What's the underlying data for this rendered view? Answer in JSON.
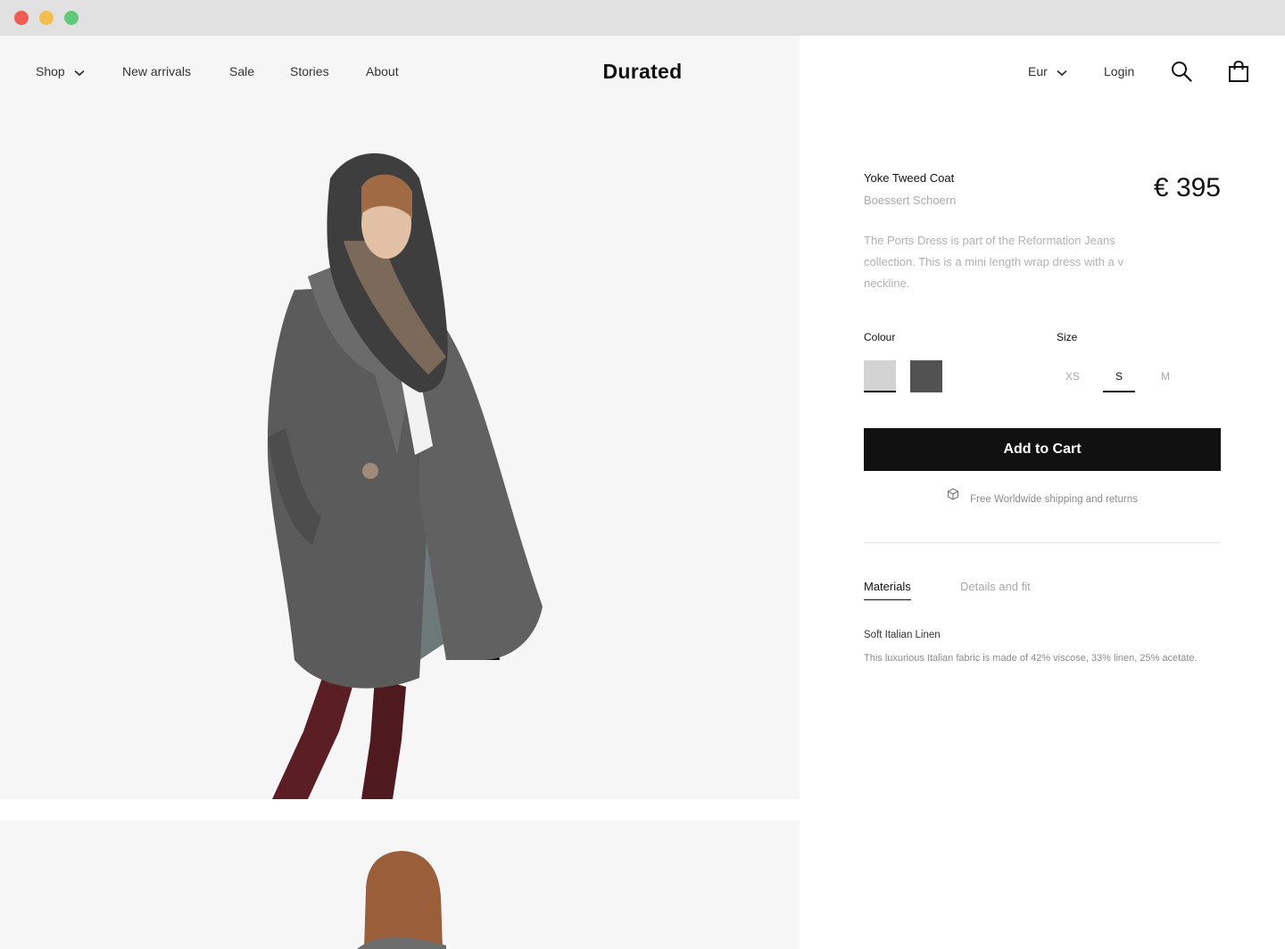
{
  "nav": {
    "left": [
      {
        "label": "Shop",
        "has_dropdown": true
      },
      {
        "label": "New arrivals"
      },
      {
        "label": "Sale"
      },
      {
        "label": "Stories"
      },
      {
        "label": "About"
      }
    ],
    "logo": "Durated",
    "currency": {
      "label": "Eur",
      "has_dropdown": true
    },
    "login": "Login",
    "icons": [
      "search-icon",
      "shopping-bag-icon"
    ]
  },
  "product": {
    "name": "Yoke Tweed Coat",
    "brand": "Boessert Schoern",
    "price": "€ 395",
    "description": "The Ports Dress is part of the Reformation Jeans collection. This is a mini length wrap dress with a v neckline.",
    "colour_label": "Colour",
    "colours": [
      {
        "name": "light-grey",
        "hex": "#d3d3d3",
        "selected": true
      },
      {
        "name": "dark-grey",
        "hex": "#525252",
        "selected": false
      }
    ],
    "size_label": "Size",
    "sizes": [
      {
        "label": "XS",
        "selected": false
      },
      {
        "label": "S",
        "selected": true
      },
      {
        "label": "M",
        "selected": false
      }
    ],
    "cta": "Add to Cart",
    "shipping_note": "Free Worldwide shipping and returns"
  },
  "tabs": [
    {
      "label": "Materials",
      "active": true
    },
    {
      "label": "Details and fit",
      "active": false
    }
  ],
  "materials": {
    "title": "Soft Italian Linen",
    "body": "This luxurious Italian fabric is made of 42% viscose, 33% linen, 25% acetate."
  },
  "colors": {
    "gallery_bg": "#f6f6f6",
    "cta_bg": "#111111",
    "muted_text": "#a9a9a9"
  }
}
